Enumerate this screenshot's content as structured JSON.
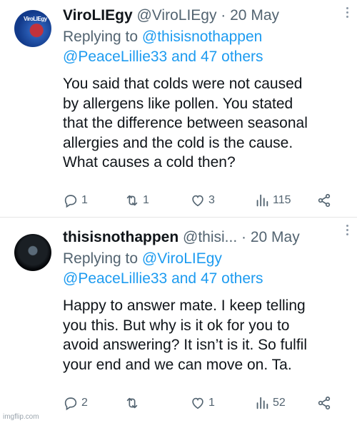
{
  "tweets": [
    {
      "display_name": "ViroLIEgy",
      "handle_and_date": "@ViroLIEgy · 20 May",
      "avatar_text": "ViroLIEgy",
      "replying_to_label": "Replying to ",
      "replying_to_first": "@thisisnothappen",
      "replying_to_second": "@PeaceLillie33 and 47 others",
      "body_lines": [
        "You said that colds were not caused",
        "by allergens like pollen. You stated",
        "that the difference between seasonal",
        "allergies and the cold is the cause.",
        "What causes a cold then?"
      ],
      "replies": "1",
      "retweets": "1",
      "likes": "3",
      "views": "115"
    },
    {
      "display_name": "thisisnothappen",
      "handle_and_date": "@thisi...  · 20 May",
      "replying_to_label": "Replying to ",
      "replying_to_first": "@ViroLIEgy",
      "replying_to_second": "@PeaceLillie33 and 47 others",
      "body_lines": [
        "Happy to answer mate. I keep telling",
        "you this. But why is it ok for you to",
        "avoid answering? It isn’t is it. So fulfil",
        "your end and we can move on. Ta."
      ],
      "replies": "2",
      "retweets": "",
      "likes": "1",
      "views": "52"
    }
  ],
  "watermark": "imgflip.com",
  "icons": {
    "reply": "reply-icon",
    "retweet": "retweet-icon",
    "like": "heart-icon",
    "views": "views-chart-icon",
    "share": "share-icon",
    "more": "more-options-icon"
  },
  "colors": {
    "link": "#1d9bf0",
    "secondary_text": "#536471",
    "primary_text": "#0f1419"
  }
}
